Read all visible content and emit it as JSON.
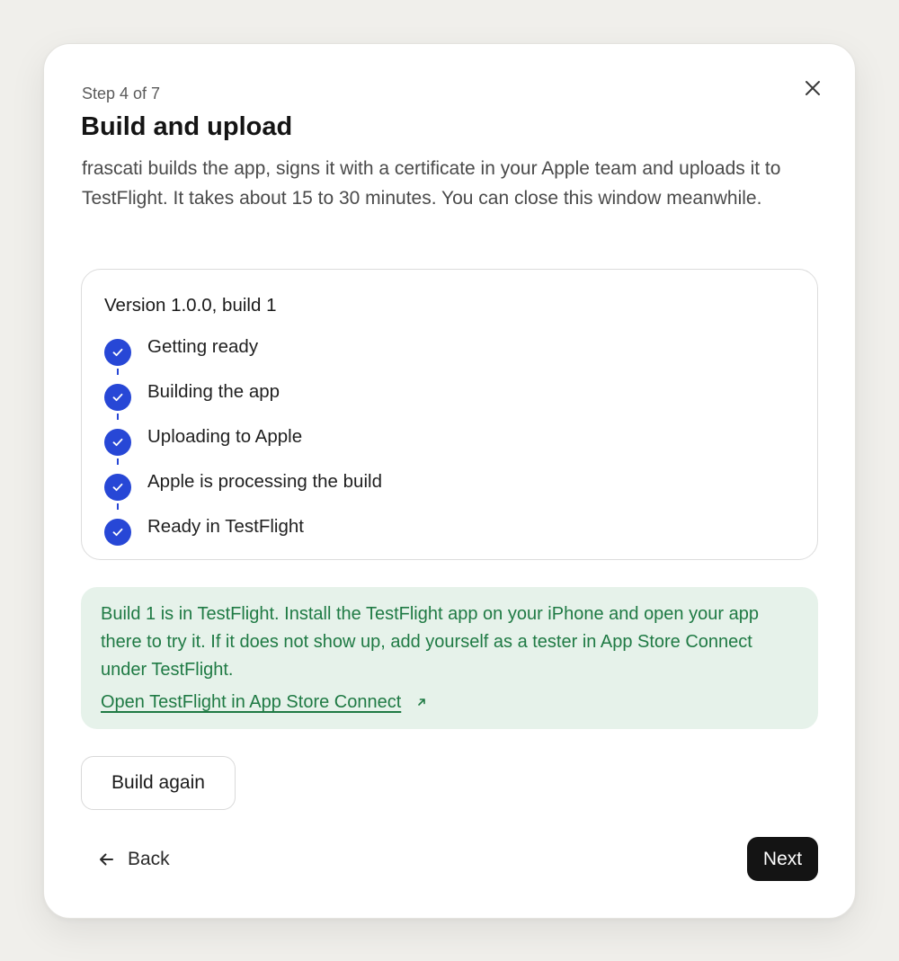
{
  "dialog": {
    "step_label": "Step 4 of 7",
    "title": "Build and upload",
    "description": "frascati builds the app, signs it with a certificate in your Apple team and uploads it to TestFlight. It takes about 15 to 30 minutes. You can close this window meanwhile.",
    "close_icon": "close-icon"
  },
  "status": {
    "version_label": "Version 1.0.0, build 1",
    "steps": [
      {
        "label": "Getting ready",
        "state": "done"
      },
      {
        "label": "Building the app",
        "state": "done"
      },
      {
        "label": "Uploading to Apple",
        "state": "done"
      },
      {
        "label": "Apple is processing the build",
        "state": "done"
      },
      {
        "label": "Ready in TestFlight",
        "state": "done"
      }
    ],
    "step_icon": "check-circle-icon"
  },
  "success": {
    "message": "Build 1 is in TestFlight. Install the TestFlight app on your iPhone and open your app there to try it. If it does not show up, add yourself as a tester in App Store Connect under TestFlight.",
    "link_label": "Open TestFlight in App Store Connect",
    "link_icon": "external-link-icon"
  },
  "actions": {
    "build_again_label": "Build again",
    "back_label": "Back",
    "back_icon": "arrow-left-icon",
    "next_label": "Next"
  },
  "colors": {
    "accent": "#2747d6",
    "success_bg": "#e6f2ea",
    "success_text": "#1f7a44",
    "primary_button": "#141414",
    "background": "#f0efeb"
  }
}
